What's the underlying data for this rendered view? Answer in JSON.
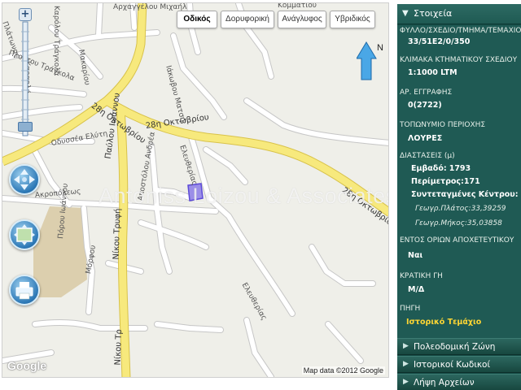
{
  "map": {
    "type_buttons": [
      {
        "label": "Οδικός",
        "active": true
      },
      {
        "label": "Δορυφορική",
        "active": false
      },
      {
        "label": "Ανάγλυφος",
        "active": false
      },
      {
        "label": "Υβριδικός",
        "active": false
      }
    ],
    "north_label": "N",
    "google_logo": "Google",
    "attribution": "Map data ©2012 Google",
    "watermark": "Antoniss Loizou & Associates",
    "streets": {
      "s1": "Αρχαγγέλου Μιχαήλ",
      "s2": "Καρόλου Τράγκολα",
      "s3": "Πλάτωνος",
      "s4": "Καραολή",
      "s5": "Πλούτου Τράγκολα",
      "s6": "Μακαρίου",
      "s7": "Ιάκωβου Ματσή",
      "s8": "Κομματιού",
      "s9": "28η Οκτωβρίου",
      "s10": "Παύλου Ιωάννου",
      "s11": "28η Οκτωβρίου",
      "s12": "Οδυσσέα Ελύτη",
      "s13": "Αποστόλου Ανδρέα",
      "s14": "Ελευθερίας",
      "s15": "28η Οκτωβρίου",
      "s16": "Ακροπόλεως",
      "s17": "Νίκου Τρυφή",
      "s18": "Πόρου Ιωάννου",
      "s19": "Μόρφου",
      "s20": "Ελευθερίας",
      "s21": "Νίκου Τρ"
    }
  },
  "panel": {
    "header": {
      "arrow": "▼",
      "title": "Στοιχεία"
    },
    "fields": {
      "sheet_label": "ΦΥΛΛΟ/ΣΧΕΔΙΟ/ΤΜΗΜΑ/ΤΕΜΑΧΙΟ",
      "sheet_value": "33/51E2/0/350",
      "scale_label": "ΚΛΙΜΑΚΑ ΚΤΗΜΑΤΙΚΟΥ ΣΧΕΔΙΟΥ",
      "scale_value": "1:1000 LTM",
      "reg_label": "ΑΡ. ΕΓΓΡΑΦΗΣ",
      "reg_value": "0(2722)",
      "place_label": "ΤΟΠΩΝΥΜΙΟ ΠΕΡΙΟΧΗΣ",
      "place_value": "ΛΟΥΡΕΣ",
      "dim_label": "ΔΙΑΣΤΑΣΕΙΣ (μ)",
      "area_label": "Εμβαδό:",
      "area_value": "1793",
      "perim_label": "Περίμετρος:",
      "perim_value": "171",
      "center_label": "Συντεταγμένες Κέντρου:",
      "lat": "Γεωγρ.Πλάτος:33,39259",
      "lon": "Γεωγρ.Μήκος:35,03858",
      "sewer_label": "ΕΝΤΟΣ ΟΡΙΩΝ ΑΠΟΧΕΤΕΥΤΙΚΟΥ",
      "sewer_value": "Ναι",
      "state_label": "ΚΡΑΤΙΚΗ ΓΗ",
      "state_value": "Μ/Δ",
      "source_label": "ΠΗΓΗ",
      "source_link": "Ιστορικό Τεμάχιο"
    },
    "accordion": [
      {
        "arrow": "▶",
        "label": "Πολεοδομική Ζώνη"
      },
      {
        "arrow": "▶",
        "label": "Ιστορικοί Κωδικοί"
      },
      {
        "arrow": "▶",
        "label": "Λήψη Αρχείων"
      }
    ]
  },
  "colors": {
    "panel_bg": "#1f5a54",
    "panel_header": "#2d6a63",
    "link_yellow": "#ffd633",
    "main_road": "#f6e77a",
    "parcel": "#9b8ee8"
  }
}
